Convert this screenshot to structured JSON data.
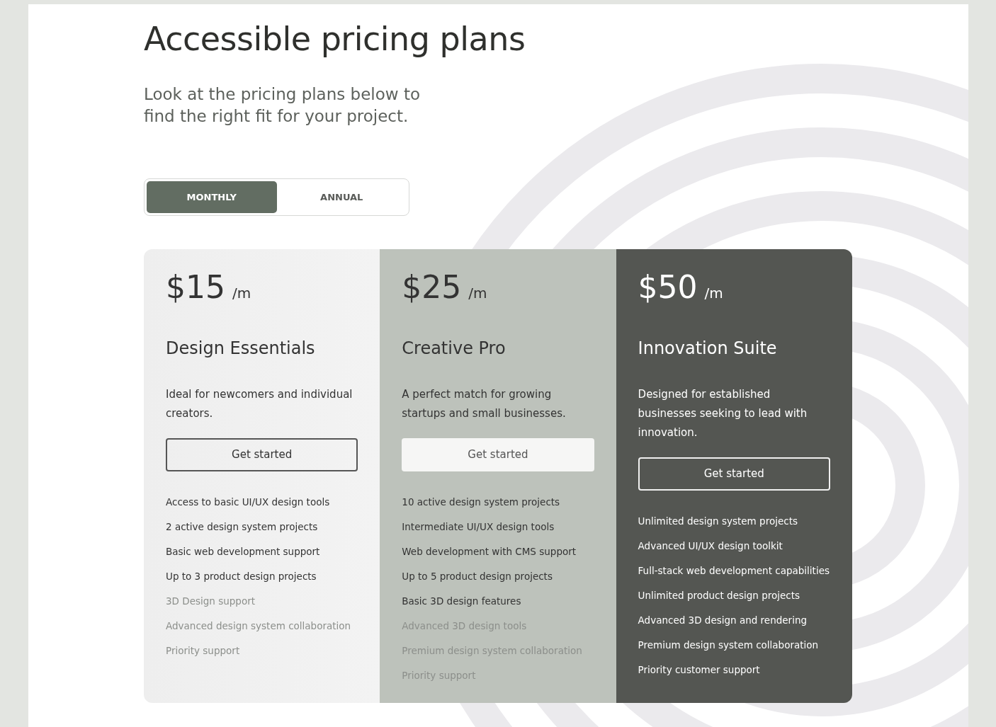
{
  "title": "Accessible pricing plans",
  "subtitle": "Look at the pricing plans below to find the right fit for your project.",
  "billing_toggle": [
    {
      "label": "MONTHLY",
      "selected": true
    },
    {
      "label": "ANNUAL",
      "selected": false
    }
  ],
  "plans": [
    {
      "kind": "light",
      "price": "$15",
      "period": "/m",
      "name": "Design Essentials",
      "description": "Ideal for newcomers and individual creators.",
      "button": "Get started",
      "features": [
        {
          "text": "Access to basic UI/UX design tools",
          "included": true
        },
        {
          "text": "2 active design system projects",
          "included": true
        },
        {
          "text": "Basic web development support",
          "included": true
        },
        {
          "text": "Up to 3 product design projects",
          "included": true
        },
        {
          "text": "3D Design support",
          "included": false
        },
        {
          "text": "Advanced design system collaboration",
          "included": false
        },
        {
          "text": "Priority support",
          "included": false
        }
      ]
    },
    {
      "kind": "sage",
      "price": "$25",
      "period": "/m",
      "name": "Creative Pro",
      "description": "A perfect match for growing startups and small businesses.",
      "button": "Get started",
      "features": [
        {
          "text": "10 active design system projects",
          "included": true
        },
        {
          "text": "Intermediate UI/UX design tools",
          "included": true
        },
        {
          "text": "Web development with CMS support",
          "included": true
        },
        {
          "text": "Up to 5 product design projects",
          "included": true
        },
        {
          "text": "Basic 3D design features",
          "included": true
        },
        {
          "text": "Advanced 3D design tools",
          "included": false
        },
        {
          "text": "Premium design system collaboration",
          "included": false
        },
        {
          "text": "Priority support",
          "included": false
        }
      ]
    },
    {
      "kind": "dark",
      "price": "$50",
      "period": "/m",
      "name": "Innovation Suite",
      "description": "Designed for established businesses seeking to lead with innovation.",
      "button": "Get started",
      "features": [
        {
          "text": "Unlimited design system projects",
          "included": true
        },
        {
          "text": "Advanced UI/UX design toolkit",
          "included": true
        },
        {
          "text": "Full-stack web development capabilities",
          "included": true
        },
        {
          "text": "Unlimited product design projects",
          "included": true
        },
        {
          "text": "Advanced 3D design and rendering",
          "included": true
        },
        {
          "text": "Premium design system collaboration",
          "included": true
        },
        {
          "text": "Priority customer support",
          "included": true
        }
      ]
    }
  ]
}
